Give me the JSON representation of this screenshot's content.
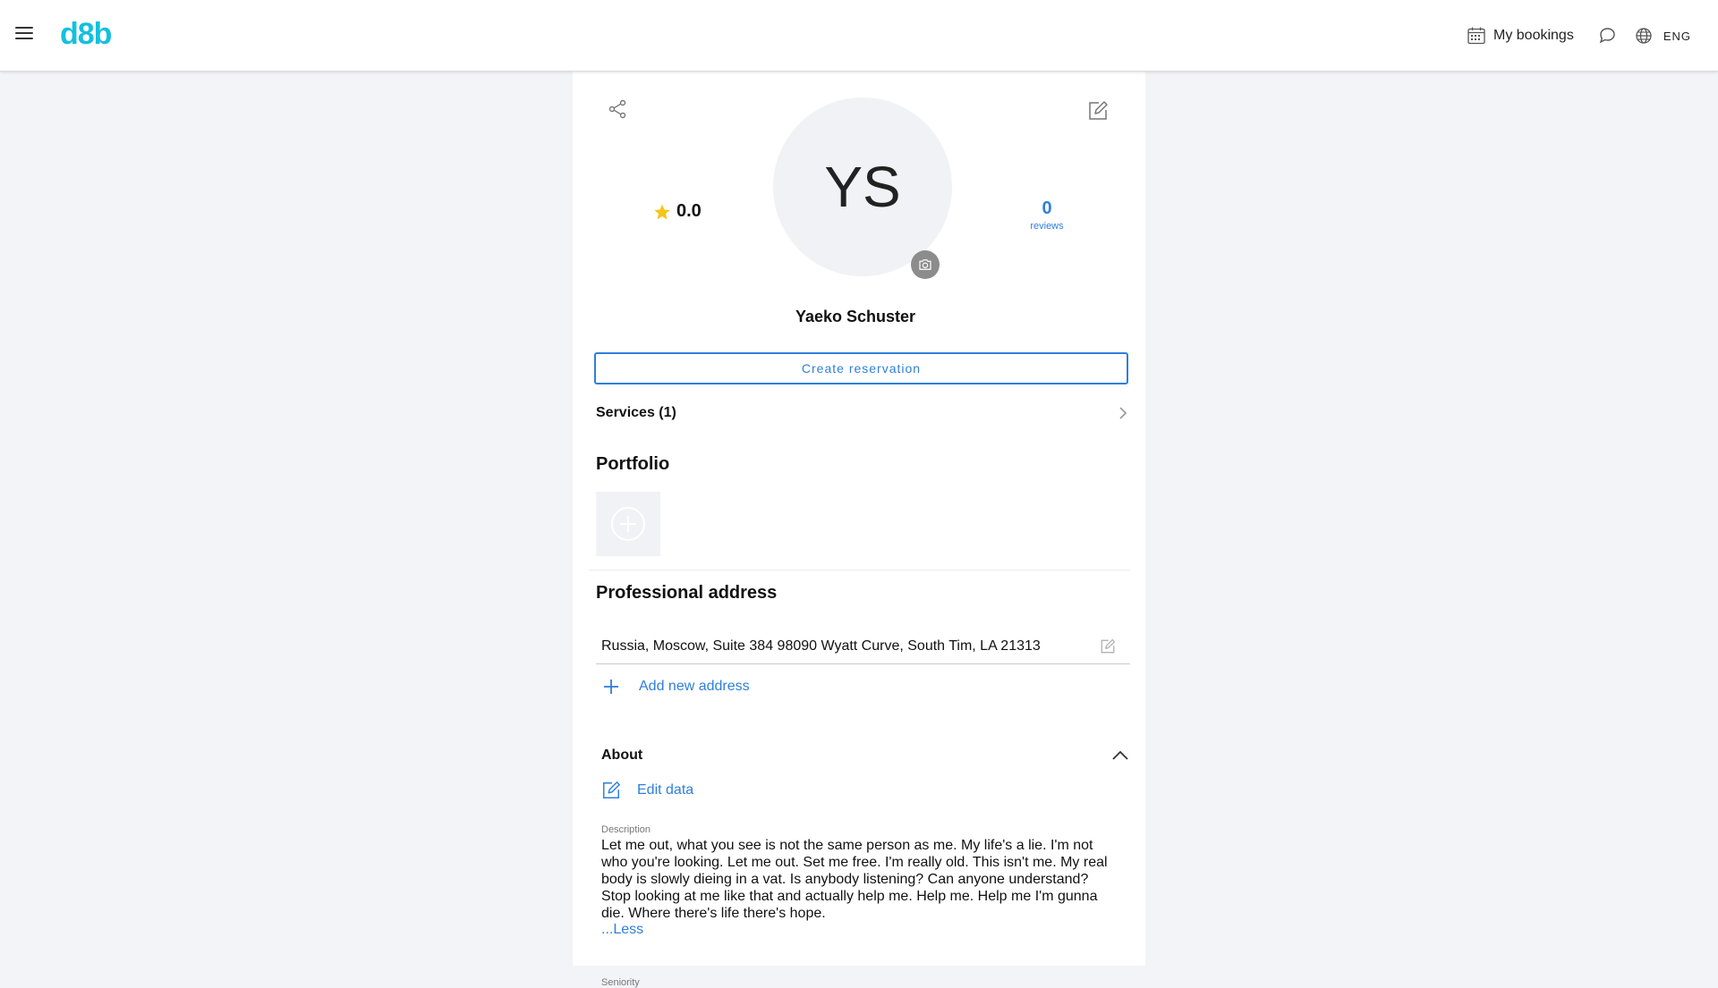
{
  "header": {
    "logo": "d8b",
    "bookings_label": "My bookings",
    "language": "ENG",
    "icons": [
      "menu-icon",
      "calendar-icon",
      "chat-icon",
      "globe-icon"
    ]
  },
  "profile": {
    "initials": "YS",
    "rating": "0.0",
    "reviews_count": "0",
    "reviews_label": "reviews",
    "name": "Yaeko Schuster",
    "reserve_label": "Create reservation",
    "services_label": "Services (1)"
  },
  "portfolio": {
    "title": "Portfolio"
  },
  "address": {
    "title": "Professional address",
    "value": "Russia, Moscow, Suite 384 98090 Wyatt Curve, South Tim, LA 21313",
    "add_label": "Add new address"
  },
  "about": {
    "title": "About",
    "edit_label": "Edit data",
    "description_label": "Description",
    "description": "Let me out, what you see is not the same person as me. My life's a lie. I'm not who you're looking. Let me out. Set me free. I'm really old. This isn't me. My real body is slowly dieing in a vat. Is anybody listening? Can anyone understand? Stop looking at me like that and actually help me. Help me. Help me I'm gunna die. Where there's life there's hope.",
    "less_label": "...Less",
    "seniority_label": "Seniority"
  },
  "colors": {
    "accent": "#2e7fdc",
    "logo": "#14c0de",
    "star": "#f5c518",
    "background": "#f3f4f7"
  }
}
